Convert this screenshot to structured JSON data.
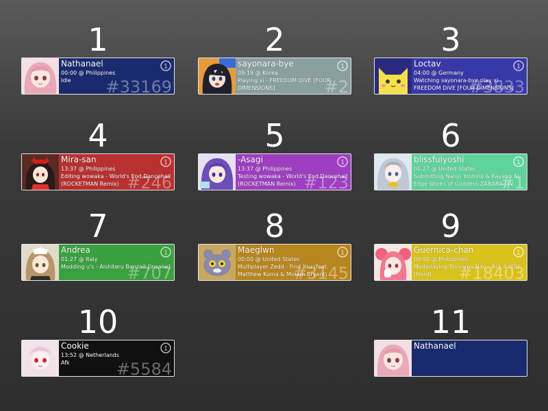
{
  "colors": {
    "background_top": "#5a5a5a",
    "background_bottom": "#2e2e2e",
    "card_border": "#e6e6e6"
  },
  "mode_icon_label": "1",
  "cards": [
    {
      "number": "1",
      "username": "Nathanael",
      "time_location": "00:00 @ Philippines",
      "status": "Idle",
      "rank": "#33169",
      "bg_color": "#1a2a6e",
      "avatar": "pink-hair-anime-girl"
    },
    {
      "number": "2",
      "username": "sayonara-bye",
      "time_location": "09:19 @ Korea",
      "status": "Playing xi - FREEDOM DiVE [FOUR DIMENSIONS]",
      "rank": "#2",
      "bg_color": "#8aa0a0",
      "avatar": "dark-hair-anime-boy"
    },
    {
      "number": "3",
      "username": "Loctav",
      "time_location": "04:00 @ Germany",
      "status": "Watching sayonara-bye play xi - FREEDOM DiVE [FOUR DIMENSIONS]",
      "rank": "#3833",
      "bg_color": "#3838a8",
      "avatar": "yellow-cat"
    },
    {
      "number": "4",
      "username": "Mira-san",
      "time_location": "13:37 @ Philippines",
      "status": "Editing wowaka - World's End Dancehall (ROCKETMAN Remix)",
      "rank": "#246",
      "bg_color": "#b83030",
      "avatar": "shrine-maiden-girl"
    },
    {
      "number": "5",
      "username": "-Asagi",
      "time_location": "13:37 @ Philippines",
      "status": "Testing wowaka - World's End Dancehall (ROCKETMAN Remix)",
      "rank": "#123",
      "bg_color": "#9d3fc0",
      "avatar": "purple-hair-anime-girl"
    },
    {
      "number": "6",
      "username": "blissfulyoshi",
      "time_location": "01:27 @ United States",
      "status": "Submitting Nanjo Yoshino & Kayano Ai - Edge Works of Goddess ZABABA [TV...",
      "rank": "#1",
      "bg_color": "#5fd39b",
      "avatar": "silver-hair-anime-girl"
    },
    {
      "number": "7",
      "username": "Andrea",
      "time_location": "01:27 @ Italy",
      "status": "Modding u's - Aishiteru Banzai! [Insane]",
      "rank": "#707",
      "bg_color": "#3aa040",
      "avatar": "maid-girl"
    },
    {
      "number": "8",
      "username": "Maeglwn",
      "time_location": "00:00 @ United States",
      "status": "Multiplayer Zedd - Find You (feat. Matthew Koma & Miriam Bryant)",
      "rank": "#3145",
      "bg_color": "#b8861e",
      "avatar": "creature"
    },
    {
      "number": "9",
      "username": "Guernica-chan",
      "time_location": "00:00 @ Philippines",
      "status": "Multiplaying Touyama Nao - ALL 4 YOU [Hard]",
      "rank": "#18403",
      "bg_color": "#d9c21c",
      "avatar": "pink-twintail-girl"
    },
    {
      "number": "10",
      "username": "Cookie",
      "time_location": "13:52 @ Netherlands",
      "status": "Afk",
      "rank": "#5584",
      "bg_color": "#101010",
      "avatar": "white-hair-red-eyes-girl"
    },
    {
      "number": "11",
      "username": "Nathanael",
      "time_location": "",
      "status": "",
      "rank": "",
      "bg_color": "#1a2a6e",
      "avatar": "pink-hair-anime-girl"
    }
  ]
}
